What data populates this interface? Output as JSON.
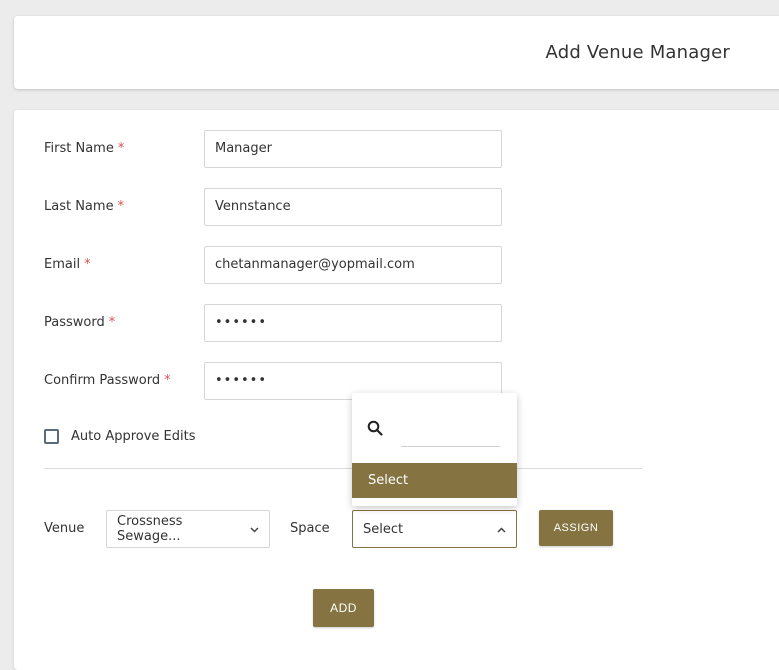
{
  "header": {
    "title": "Add Venue Manager"
  },
  "form": {
    "first_name": {
      "label": "First Name",
      "required": "*",
      "value": "Manager"
    },
    "last_name": {
      "label": "Last Name",
      "required": "*",
      "value": "Vennstance"
    },
    "email": {
      "label": "Email",
      "required": "*",
      "value": "chetanmanager@yopmail.com"
    },
    "password": {
      "label": "Password",
      "required": "*",
      "value": "••••••"
    },
    "confirm_password": {
      "label": "Confirm Password",
      "required": "*",
      "value": "••••••"
    },
    "auto_approve": {
      "label": "Auto Approve Edits",
      "checked": false
    }
  },
  "assignment": {
    "venue_label": "Venue",
    "venue_value": "Crossness Sewage...",
    "space_label": "Space",
    "space_value": "Select",
    "assign_button": "ASSIGN"
  },
  "dropdown": {
    "search_value": "",
    "options": [
      {
        "label": "Select",
        "selected": true
      }
    ]
  },
  "actions": {
    "add_button": "ADD"
  },
  "colors": {
    "accent": "#857341",
    "required": "#d9534f",
    "background": "#ececec"
  },
  "icons": {
    "search": "search-icon",
    "chevron_down": "chevron-down-icon",
    "chevron_up": "chevron-up-icon"
  }
}
